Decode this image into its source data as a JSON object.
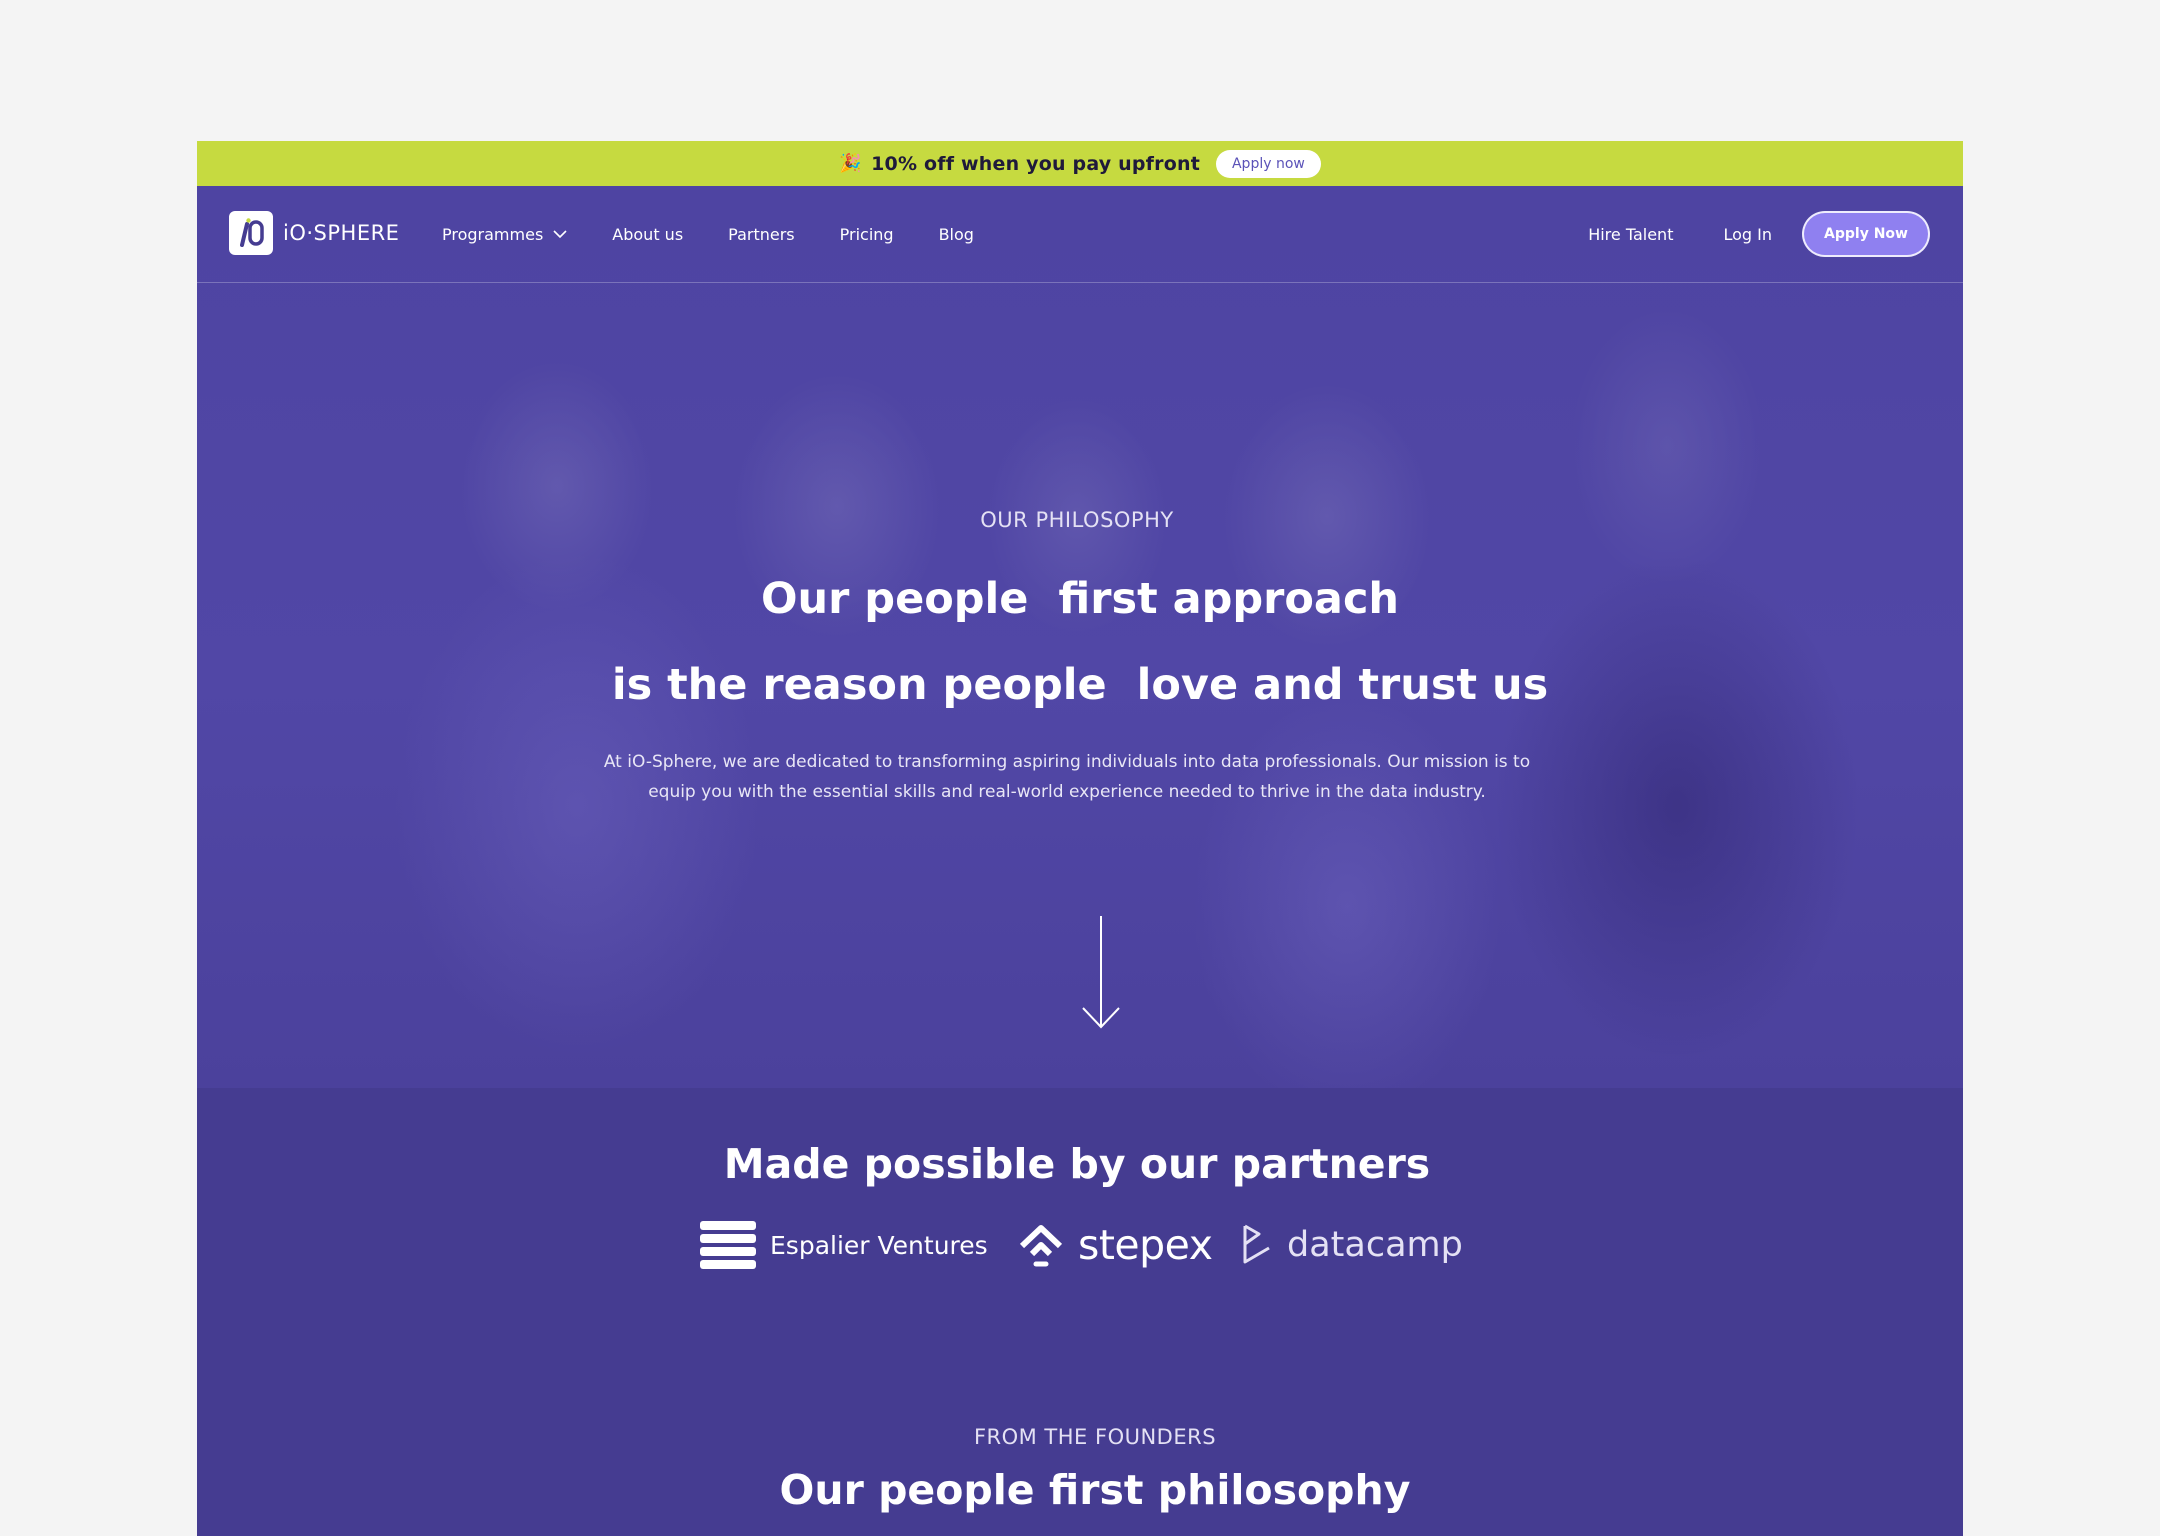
{
  "promo": {
    "emoji": "🎉",
    "text": "10% off when you pay upfront",
    "apply_label": "Apply now"
  },
  "nav": {
    "logo_text": "iO·SPHERE",
    "links": [
      {
        "label": "Programmes"
      },
      {
        "label": "About us"
      },
      {
        "label": "Partners"
      },
      {
        "label": "Pricing"
      },
      {
        "label": "Blog"
      }
    ],
    "hire_talent": "Hire Talent",
    "log_in": "Log In",
    "apply_now": "Apply Now"
  },
  "hero": {
    "eyebrow": "OUR PHILOSOPHY",
    "headline_line1": "Our people  first approach",
    "headline_line2": "is the reason people  love and trust us",
    "description_line1": "At iO-Sphere, we are dedicated to transforming aspiring individuals into data professionals. Our mission is to",
    "description_line2": "equip you with the essential skills and real-world experience needed to thrive in the data industry."
  },
  "partners": {
    "title": "Made possible by our partners",
    "items": [
      {
        "name": "Espalier Ventures"
      },
      {
        "name": "stepex"
      },
      {
        "name": "datacamp"
      }
    ]
  },
  "founders": {
    "eyebrow": "FROM THE FOUNDERS",
    "title": "Our people first philosophy"
  },
  "colors": {
    "promo_bg": "#c6da40",
    "brand_purple": "#453c91",
    "hero_overlay": "#5147a6",
    "apply_button": "#8f80f0"
  }
}
